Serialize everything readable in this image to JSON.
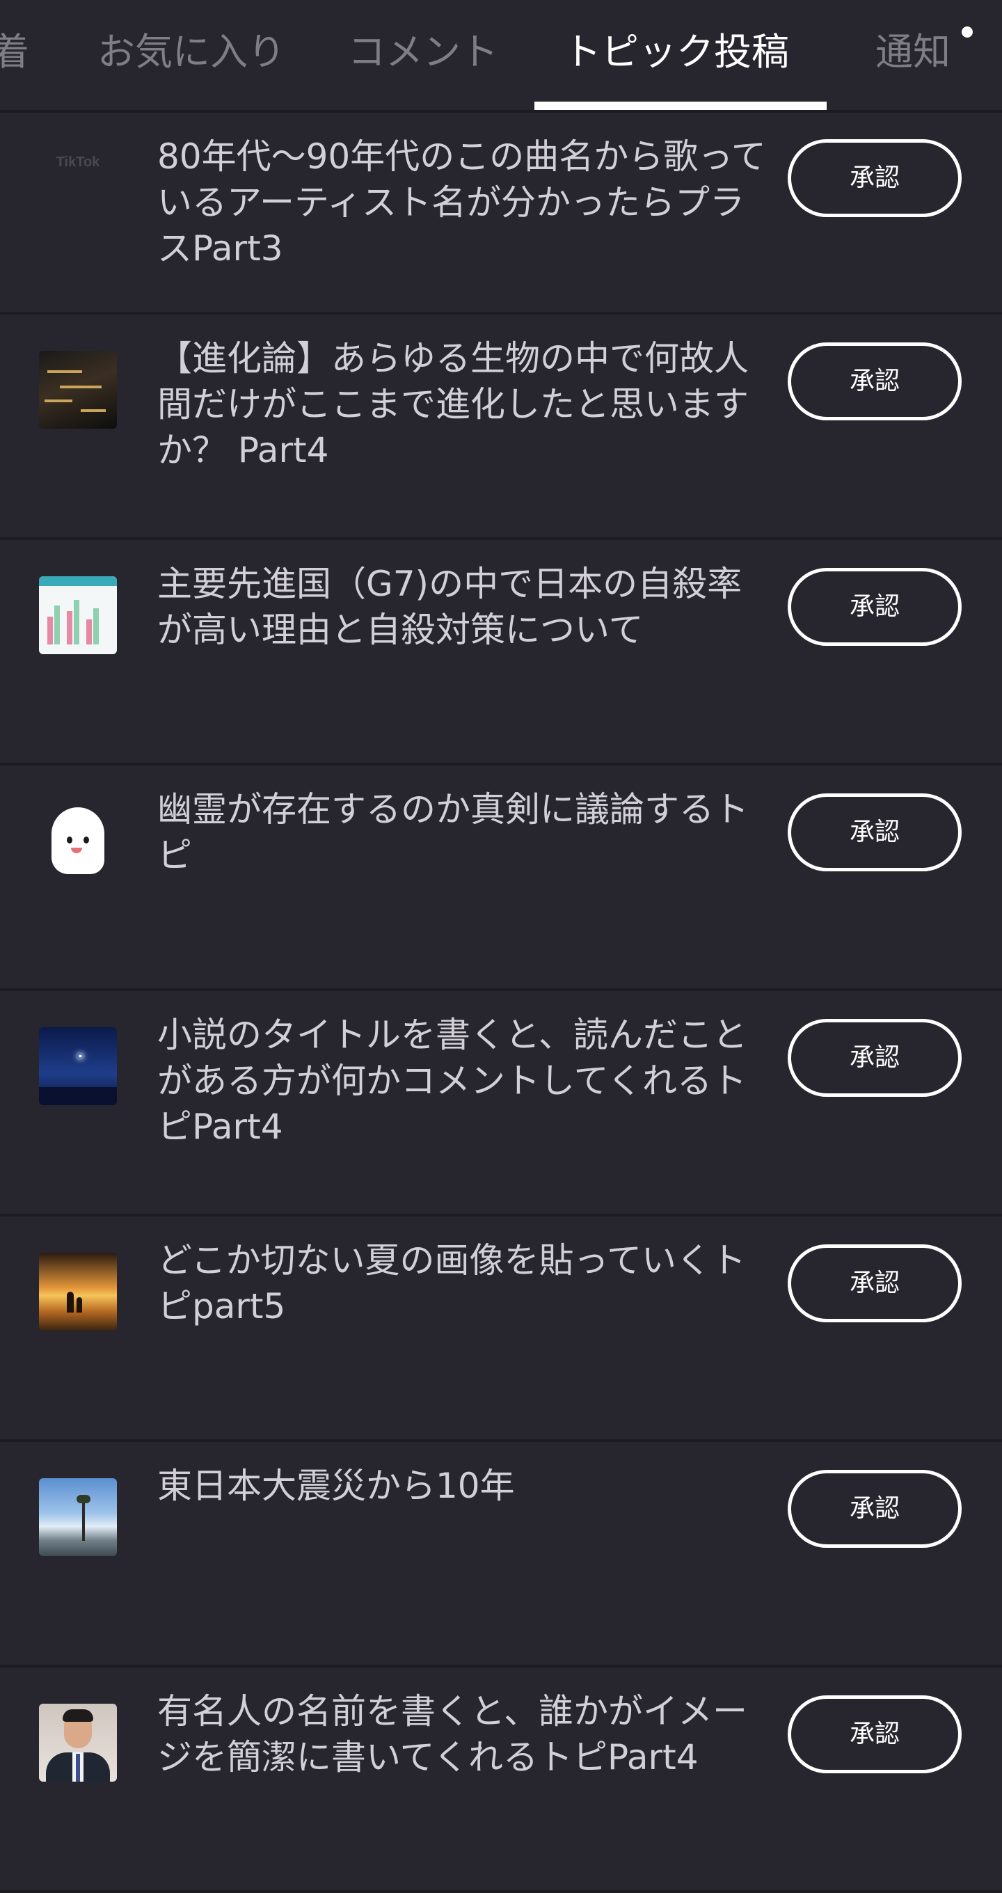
{
  "tabs": [
    {
      "label": "着",
      "active": false
    },
    {
      "label": "お気に入り",
      "active": false
    },
    {
      "label": "コメント",
      "active": false
    },
    {
      "label": "トピック投稿",
      "active": true
    },
    {
      "label": "通知",
      "active": false
    }
  ],
  "approve_label": "承認",
  "topics": [
    {
      "title": "80年代〜90年代のこの曲名から歌っているアーティスト名が分かったらプラスPart3",
      "thumbnail": "tiktok-logo",
      "thumbnail_text": "TikTok"
    },
    {
      "title": "【進化論】あらゆる生物の中で何故人間だけがここまで進化したと思いますか？ Part4",
      "thumbnail": "evolution-diagram"
    },
    {
      "title": "主要先進国（G7)の中で日本の自殺率が高い理由と自殺対策について",
      "thumbnail": "bar-chart-image"
    },
    {
      "title": "幽霊が存在するのか真剣に議論するトピ",
      "thumbnail": "ghost-illustration"
    },
    {
      "title": "小説のタイトルを書くと、読んだことがある方が何かコメントしてくれるトピPart4",
      "thumbnail": "night-sky-book-cover"
    },
    {
      "title": "どこか切ない夏の画像を貼っていくトピpart5",
      "thumbnail": "summer-sunset-photo"
    },
    {
      "title": "東日本大震災から10年",
      "thumbnail": "lone-pine-tree-photo"
    },
    {
      "title": "有名人の名前を書くと、誰かがイメージを簡潔に書いてくれるトピPart4",
      "thumbnail": "man-in-suit-photo"
    }
  ]
}
